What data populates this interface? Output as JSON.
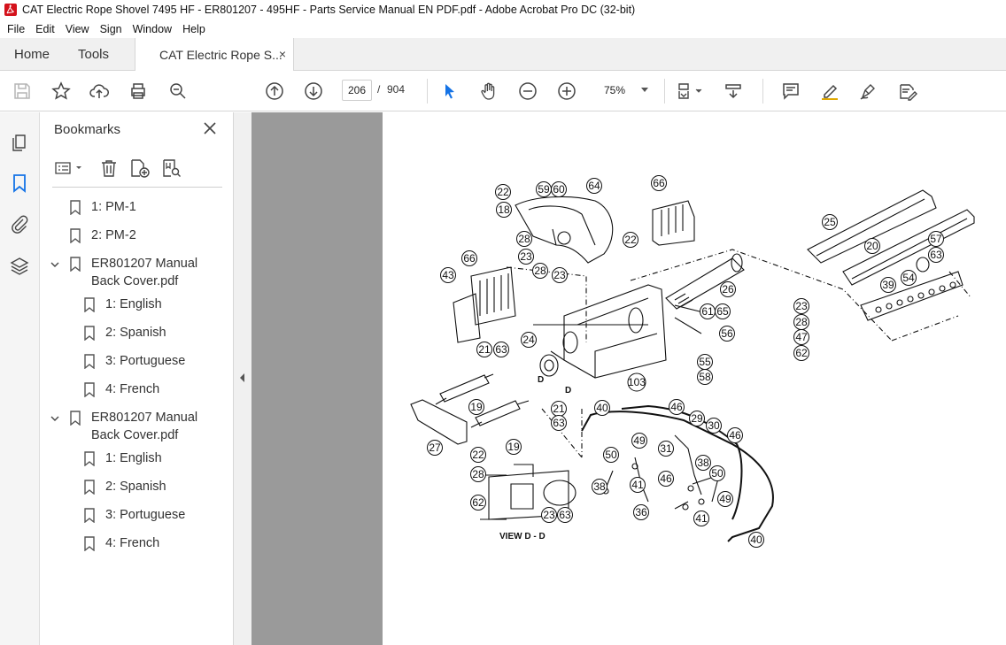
{
  "window": {
    "title": "CAT Electric Rope Shovel 7495 HF - ER801207 - 495HF - Parts Service Manual EN PDF.pdf - Adobe Acrobat Pro DC (32-bit)"
  },
  "menu": [
    "File",
    "Edit",
    "View",
    "Sign",
    "Window",
    "Help"
  ],
  "tabs": {
    "home": "Home",
    "tools": "Tools",
    "doc": "CAT Electric Rope S...",
    "close": "×"
  },
  "toolbar": {
    "page_current": "206",
    "page_sep": "/",
    "page_total": "904",
    "zoom": "75%"
  },
  "bookmarks": {
    "title": "Bookmarks",
    "items": [
      {
        "label": "1: PM-1"
      },
      {
        "label": "2: PM-2"
      },
      {
        "label": "ER801207 Manual Back Cover.pdf"
      },
      {
        "label": "1: English"
      },
      {
        "label": "2: Spanish"
      },
      {
        "label": "3: Portuguese"
      },
      {
        "label": "4: French"
      },
      {
        "label": "ER801207 Manual Back Cover.pdf"
      },
      {
        "label": "1: English"
      },
      {
        "label": "2: Spanish"
      },
      {
        "label": "3: Portuguese"
      },
      {
        "label": "4: French"
      }
    ]
  },
  "diagram": {
    "view_label": "VIEW D - D",
    "section_marks": [
      "D",
      "D"
    ],
    "callouts": [
      "22",
      "59",
      "60",
      "64",
      "66",
      "18",
      "28",
      "22",
      "23",
      "28",
      "23",
      "25",
      "20",
      "57",
      "63",
      "66",
      "43",
      "26",
      "61",
      "65",
      "39",
      "54",
      "23",
      "28",
      "47",
      "62",
      "56",
      "24",
      "21",
      "63",
      "55",
      "58",
      "103",
      "19",
      "40",
      "46",
      "29",
      "30",
      "46",
      "21",
      "63",
      "27",
      "19",
      "49",
      "31",
      "50",
      "22",
      "28",
      "38",
      "46",
      "50",
      "41",
      "38",
      "62",
      "36",
      "49",
      "23",
      "63",
      "41",
      "40"
    ]
  }
}
